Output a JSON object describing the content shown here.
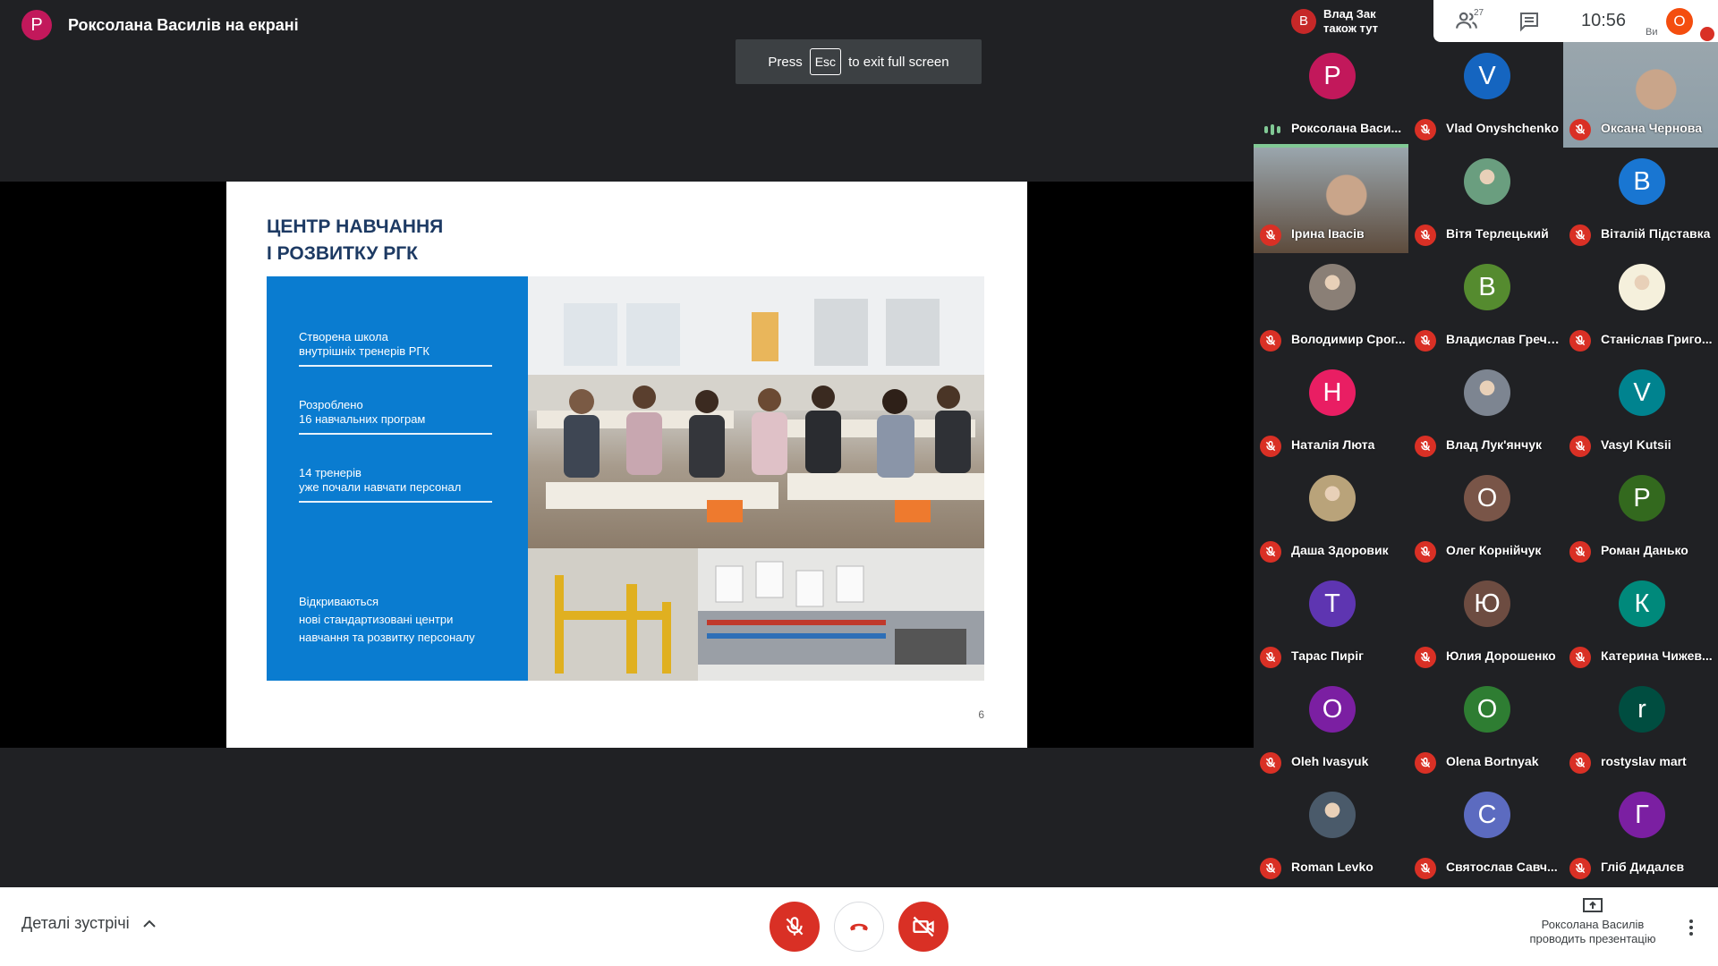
{
  "presenter": {
    "initial": "Р",
    "name": "Роксолана Василів на екрані",
    "avatar_color": "#c2185b"
  },
  "esc_hint": {
    "press": "Press",
    "key": "Esc",
    "rest": "to exit full screen"
  },
  "slide": {
    "title": "ЦЕНТР НАВЧАННЯ\nІ РОЗВИТКУ РГК",
    "items": [
      "Створена школа\nвнутрішніх тренерів РГК",
      "Розроблено\n16 навчальних програм",
      "14 тренерів\nуже почали навчати персонал",
      "Відкриваються\nнові стандартизовані центри\nнавчання та розвитку персоналу"
    ],
    "page_number": "6",
    "panel_color": "#0a7cd0"
  },
  "top_right": {
    "also_here_initial": "В",
    "also_here_text": "Влад Зак\nтакож тут",
    "people_count": "27",
    "clock": "10:56",
    "self_initial": "О",
    "self_label": "Ви"
  },
  "participants": [
    {
      "name": "Роксолана Васи...",
      "initial": "Р",
      "color": "#c2185b",
      "speaking": true
    },
    {
      "name": "Vlad Onyshchenko",
      "initial": "V",
      "color": "#1565c0"
    },
    {
      "name": "Оксана Чернова",
      "initial": "",
      "color": "#8d9ea8",
      "video": true
    },
    {
      "name": "Ірина Івасів",
      "initial": "",
      "color": "#5d4b3c",
      "video": true
    },
    {
      "name": "Вітя Терлецький",
      "initial": "",
      "color": "#6a9e7f",
      "photo": true
    },
    {
      "name": "Віталій Підставка",
      "initial": "В",
      "color": "#1976d2"
    },
    {
      "name": "Володимир Срог...",
      "initial": "",
      "color": "#8a7f76",
      "photo": true
    },
    {
      "name": "Владислав Гречк...",
      "initial": "В",
      "color": "#558b2f"
    },
    {
      "name": "Станіслав Григо...",
      "initial": "",
      "color": "#f5f0dc",
      "photo": true
    },
    {
      "name": "Наталія Люта",
      "initial": "Н",
      "color": "#e91e63"
    },
    {
      "name": "Влад Лук'янчук",
      "initial": "",
      "color": "#7d8591",
      "photo": true
    },
    {
      "name": "Vasyl Kutsii",
      "initial": "V",
      "color": "#00838f"
    },
    {
      "name": "Даша Здоровик",
      "initial": "",
      "color": "#b9a37a",
      "photo": true
    },
    {
      "name": "Олег Корнійчук",
      "initial": "О",
      "color": "#795548"
    },
    {
      "name": "Роман Данько",
      "initial": "Р",
      "color": "#33691e"
    },
    {
      "name": "Тарас Пиріг",
      "initial": "Т",
      "color": "#5e35b1"
    },
    {
      "name": "Юлия Дорошенко",
      "initial": "Ю",
      "color": "#6d4c41"
    },
    {
      "name": "Катерина Чижев...",
      "initial": "К",
      "color": "#00897b"
    },
    {
      "name": "Oleh Ivasyuk",
      "initial": "O",
      "color": "#7b1fa2"
    },
    {
      "name": "Olena Bortnyak",
      "initial": "O",
      "color": "#2e7d32"
    },
    {
      "name": "rostyslav mart",
      "initial": "r",
      "color": "#004d40"
    },
    {
      "name": "Roman Levko",
      "initial": "",
      "color": "#4a5a6a",
      "photo": true
    },
    {
      "name": "Святослав Савч...",
      "initial": "С",
      "color": "#5c6bc0"
    },
    {
      "name": "Гліб Дидалєв",
      "initial": "Г",
      "color": "#7b1fa2"
    }
  ],
  "bottom": {
    "details": "Деталі зустрічі",
    "presenting": "Роксолана Василів\nпроводить презентацію"
  },
  "icons": [
    "people-icon",
    "chat-icon",
    "mic-off-icon",
    "hangup-icon",
    "camera-off-icon",
    "present-icon",
    "more-vert-icon",
    "chevron-up-icon"
  ]
}
